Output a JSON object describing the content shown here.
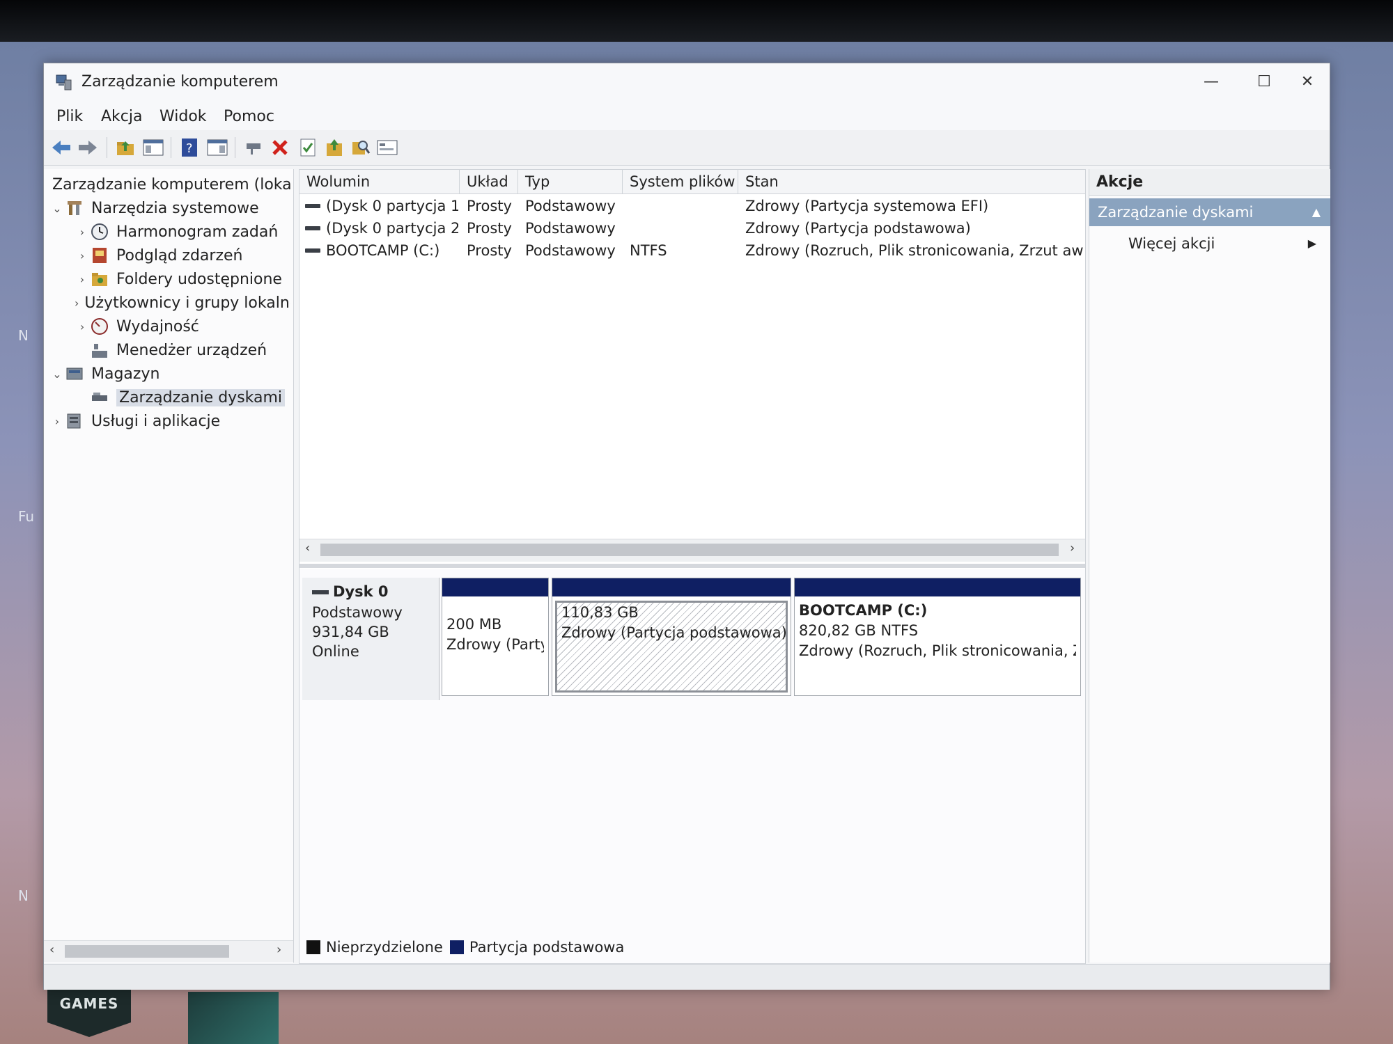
{
  "desktop": {
    "icon_games_label": "GAMES",
    "side_letters": [
      "N",
      "Fu",
      "N"
    ]
  },
  "window": {
    "title": "Zarządzanie komputerem",
    "controls": {
      "minimize": "—",
      "maximize": "☐",
      "close": "✕"
    }
  },
  "menu": [
    "Plik",
    "Akcja",
    "Widok",
    "Pomoc"
  ],
  "toolbar_icons": [
    "back-icon",
    "forward-icon",
    "up-folder-icon",
    "show-hide-tree-icon",
    "help-icon",
    "show-hide-action-pane-icon",
    "connect-icon",
    "delete-icon",
    "properties-icon",
    "import-icon",
    "search-icon",
    "console-icon"
  ],
  "tree": {
    "root": "Zarządzanie komputerem (lokalne)",
    "items": [
      {
        "label": "Narzędzia systemowe",
        "level": 1,
        "expanded": true
      },
      {
        "label": "Harmonogram zadań",
        "level": 2
      },
      {
        "label": "Podgląd zdarzeń",
        "level": 2
      },
      {
        "label": "Foldery udostępnione",
        "level": 2
      },
      {
        "label": "Użytkownicy i grupy lokalne",
        "level": 2
      },
      {
        "label": "Wydajność",
        "level": 2
      },
      {
        "label": "Menedżer urządzeń",
        "level": 2
      },
      {
        "label": "Magazyn",
        "level": 1,
        "expanded": true
      },
      {
        "label": "Zarządzanie dyskami",
        "level": 2,
        "selected": true
      },
      {
        "label": "Usługi i aplikacje",
        "level": 1
      }
    ]
  },
  "volumes": {
    "columns": [
      "Wolumin",
      "Układ",
      "Typ",
      "System plików",
      "Stan"
    ],
    "rows": [
      [
        "(Dysk 0 partycja 1)",
        "Prosty",
        "Podstawowy",
        "",
        "Zdrowy (Partycja systemowa EFI)"
      ],
      [
        "(Dysk 0 partycja 2)",
        "Prosty",
        "Podstawowy",
        "",
        "Zdrowy (Partycja podstawowa)"
      ],
      [
        "BOOTCAMP (C:)",
        "Prosty",
        "Podstawowy",
        "NTFS",
        "Zdrowy (Rozruch, Plik stronicowania, Zrzut awaryjny)"
      ]
    ]
  },
  "disk": {
    "name": "Dysk 0",
    "type": "Podstawowy",
    "size": "931,84 GB",
    "status": "Online",
    "partitions": [
      {
        "name": "",
        "size": "200 MB",
        "status": "Zdrowy (Partycja systemowa EFI)"
      },
      {
        "name": "",
        "size": "110,83 GB",
        "status": "Zdrowy (Partycja podstawowa)"
      },
      {
        "name": "BOOTCAMP  (C:)",
        "size": "820,82 GB NTFS",
        "status": "Zdrowy (Rozruch, Plik stronicowania, Zrzut awaryjny)"
      }
    ]
  },
  "legend": [
    {
      "label": "Nieprzydzielone",
      "color": "#111111"
    },
    {
      "label": "Partycja podstawowa",
      "color": "#0f1f63"
    }
  ],
  "actions": {
    "header": "Akcje",
    "section": "Zarządzanie dyskami",
    "more": "Więcej akcji"
  }
}
